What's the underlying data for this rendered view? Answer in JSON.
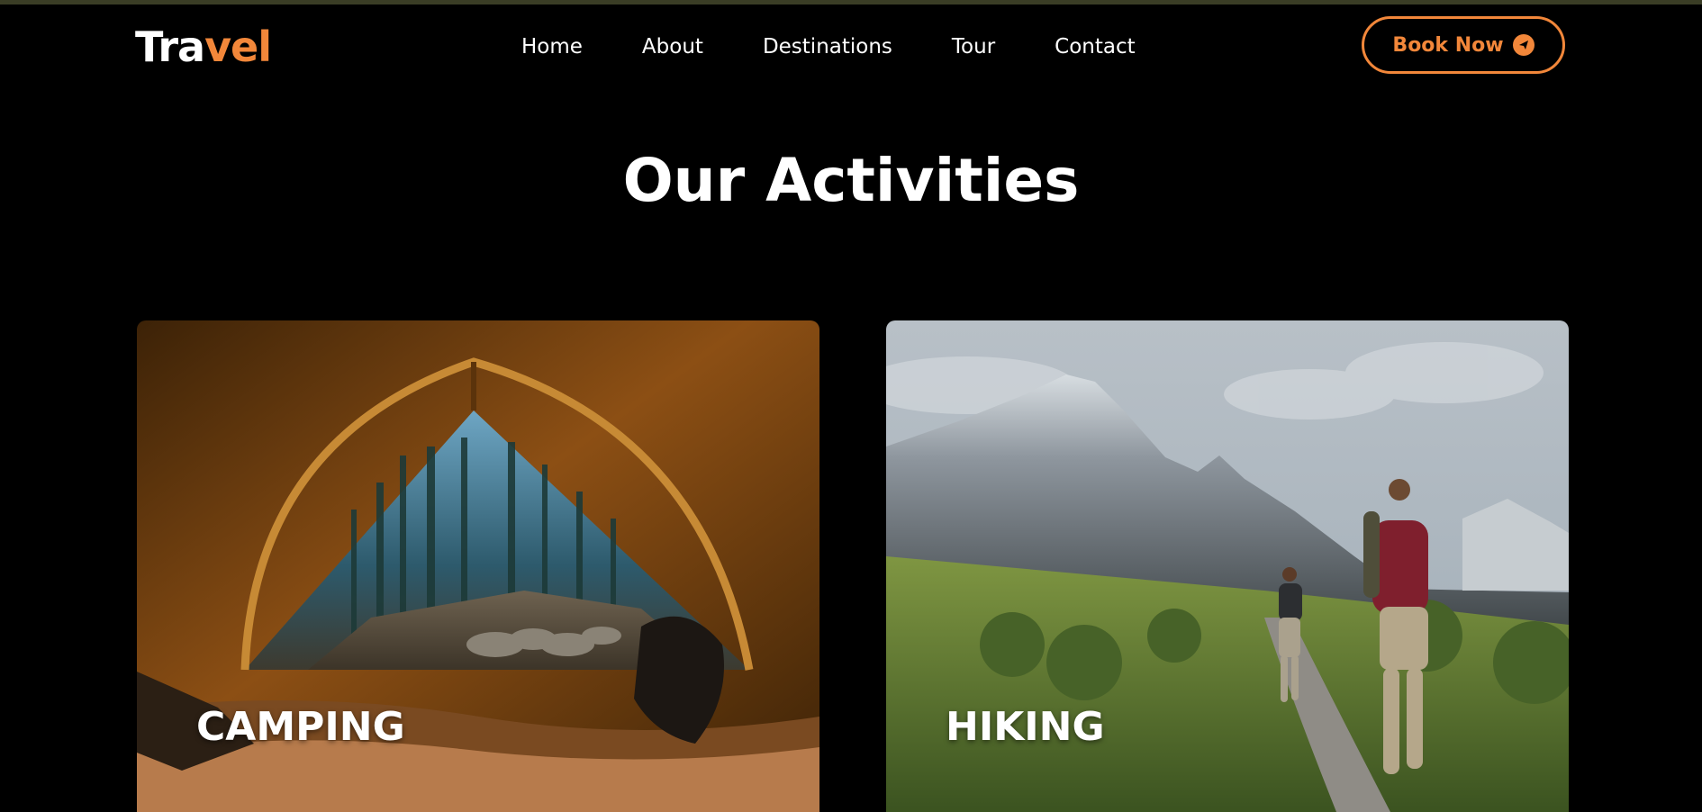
{
  "brand": {
    "logo_part1": "Tra",
    "logo_part2": "vel"
  },
  "nav": {
    "items": [
      "Home",
      "About",
      "Destinations",
      "Tour",
      "Contact"
    ]
  },
  "header": {
    "book_label": "Book Now",
    "book_icon": "send-icon"
  },
  "section": {
    "title": "Our Activities"
  },
  "cards": [
    {
      "label": "CAMPING"
    },
    {
      "label": "HIKING"
    }
  ],
  "colors": {
    "accent": "#f2873a",
    "background": "#000000"
  }
}
